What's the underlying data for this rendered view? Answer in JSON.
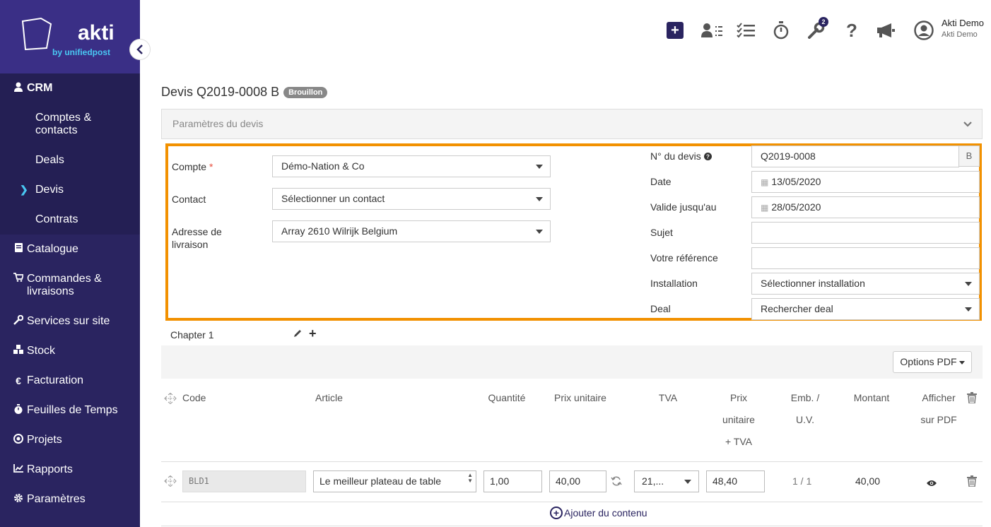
{
  "brand": {
    "name": "akti",
    "tagline": "by unifiedpost"
  },
  "sidebar": {
    "crm": "CRM",
    "crm_items": [
      {
        "label": "Comptes & contacts"
      },
      {
        "label": "Deals"
      },
      {
        "label": "Devis"
      },
      {
        "label": "Contrats"
      }
    ],
    "items": [
      {
        "label": "Catalogue",
        "icon": "book-icon"
      },
      {
        "label": "Commandes & livraisons",
        "icon": "cart-icon"
      },
      {
        "label": "Services sur site",
        "icon": "wrench-icon"
      },
      {
        "label": "Stock",
        "icon": "cubes-icon"
      },
      {
        "label": "Facturation",
        "icon": "euro-icon"
      },
      {
        "label": "Feuilles de Temps",
        "icon": "stopwatch-icon"
      },
      {
        "label": "Projets",
        "icon": "target-icon"
      },
      {
        "label": "Rapports",
        "icon": "chart-icon"
      },
      {
        "label": "Paramètres",
        "icon": "gear-icon"
      }
    ]
  },
  "topbar": {
    "badge_count": "2",
    "user_name": "Akti Demo",
    "user_company": "Akti Demo"
  },
  "quote": {
    "title": "Devis Q2019-0008 B",
    "status": "Brouillon",
    "params_header": "Paramètres du devis"
  },
  "form": {
    "compte_label": "Compte",
    "required_mark": "*",
    "compte_value": "Démo-Nation & Co",
    "contact_label": "Contact",
    "contact_value": "Sélectionner un contact",
    "adresse_label_1": "Adresse de",
    "adresse_label_2": "livraison",
    "adresse_value": "Array 2610 Wilrijk Belgium",
    "numero_label": "N° du devis",
    "numero_value": "Q2019-0008",
    "numero_suffix": "B",
    "date_label": "Date",
    "date_value": "13/05/2020",
    "valide_label": "Valide jusqu'au",
    "valide_value": "28/05/2020",
    "sujet_label": "Sujet",
    "sujet_value": "",
    "reference_label": "Votre référence",
    "reference_value": "",
    "installation_label": "Installation",
    "installation_value": "Sélectionner installation",
    "deal_label": "Deal",
    "deal_value": "Rechercher deal"
  },
  "chapter": {
    "name": "Chapter 1",
    "pdf_options": "Options PDF"
  },
  "table": {
    "headers": {
      "code": "Code",
      "article": "Article",
      "quantite": "Quantité",
      "prix_unitaire": "Prix unitaire",
      "tva": "TVA",
      "prix_tva_1": "Prix",
      "prix_tva_2": "unitaire",
      "prix_tva_3": "+ TVA",
      "emb_1": "Emb. /",
      "emb_2": "U.V.",
      "montant": "Montant",
      "afficher_1": "Afficher",
      "afficher_2": "sur PDF"
    },
    "row": {
      "code": "BLD1",
      "article": "Le meilleur plateau de table",
      "quantite": "1,00",
      "prix_unitaire": "40,00",
      "tva": "21,...",
      "prix_tva": "48,40",
      "emb": "1 / 1",
      "montant": "40,00"
    },
    "add_content": "Ajouter du contenu"
  },
  "colors": {
    "sidebar": "#2a2460",
    "accent": "#f29100",
    "brand_sub": "#49c7f2"
  }
}
